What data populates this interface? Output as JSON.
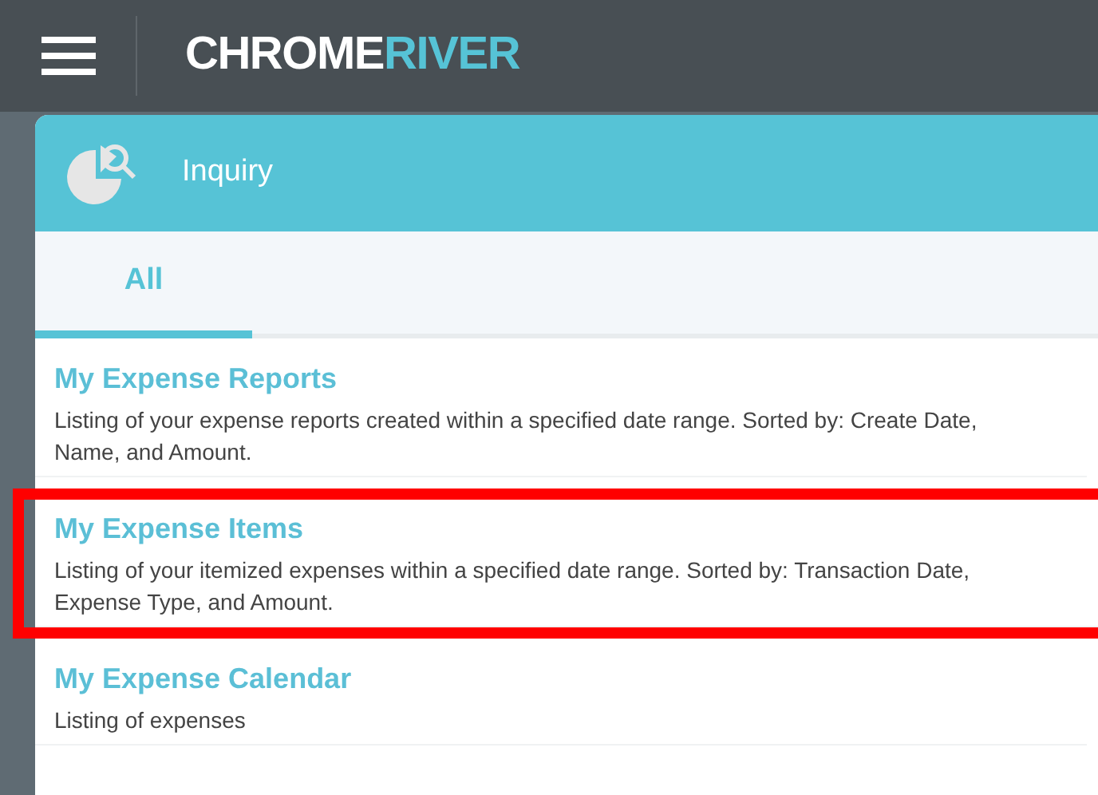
{
  "header": {
    "logo": {
      "part_1": "CHROME",
      "part_2": "RIVER"
    }
  },
  "panel": {
    "title": "Inquiry"
  },
  "tabs": [
    {
      "label": "All",
      "selected": true
    }
  ],
  "items": [
    {
      "title": "My Expense Reports",
      "description": "Listing of your expense reports created within a specified date range. Sorted by: Create Date, Name, and Amount.",
      "highlighted": false
    },
    {
      "title": "My Expense Items",
      "description": "Listing of your itemized expenses within a specified date range. Sorted by: Transaction Date, Expense Type, and Amount.",
      "highlighted": true
    },
    {
      "title": "My Expense Calendar",
      "description": "Listing of expenses",
      "highlighted": false
    }
  ]
}
